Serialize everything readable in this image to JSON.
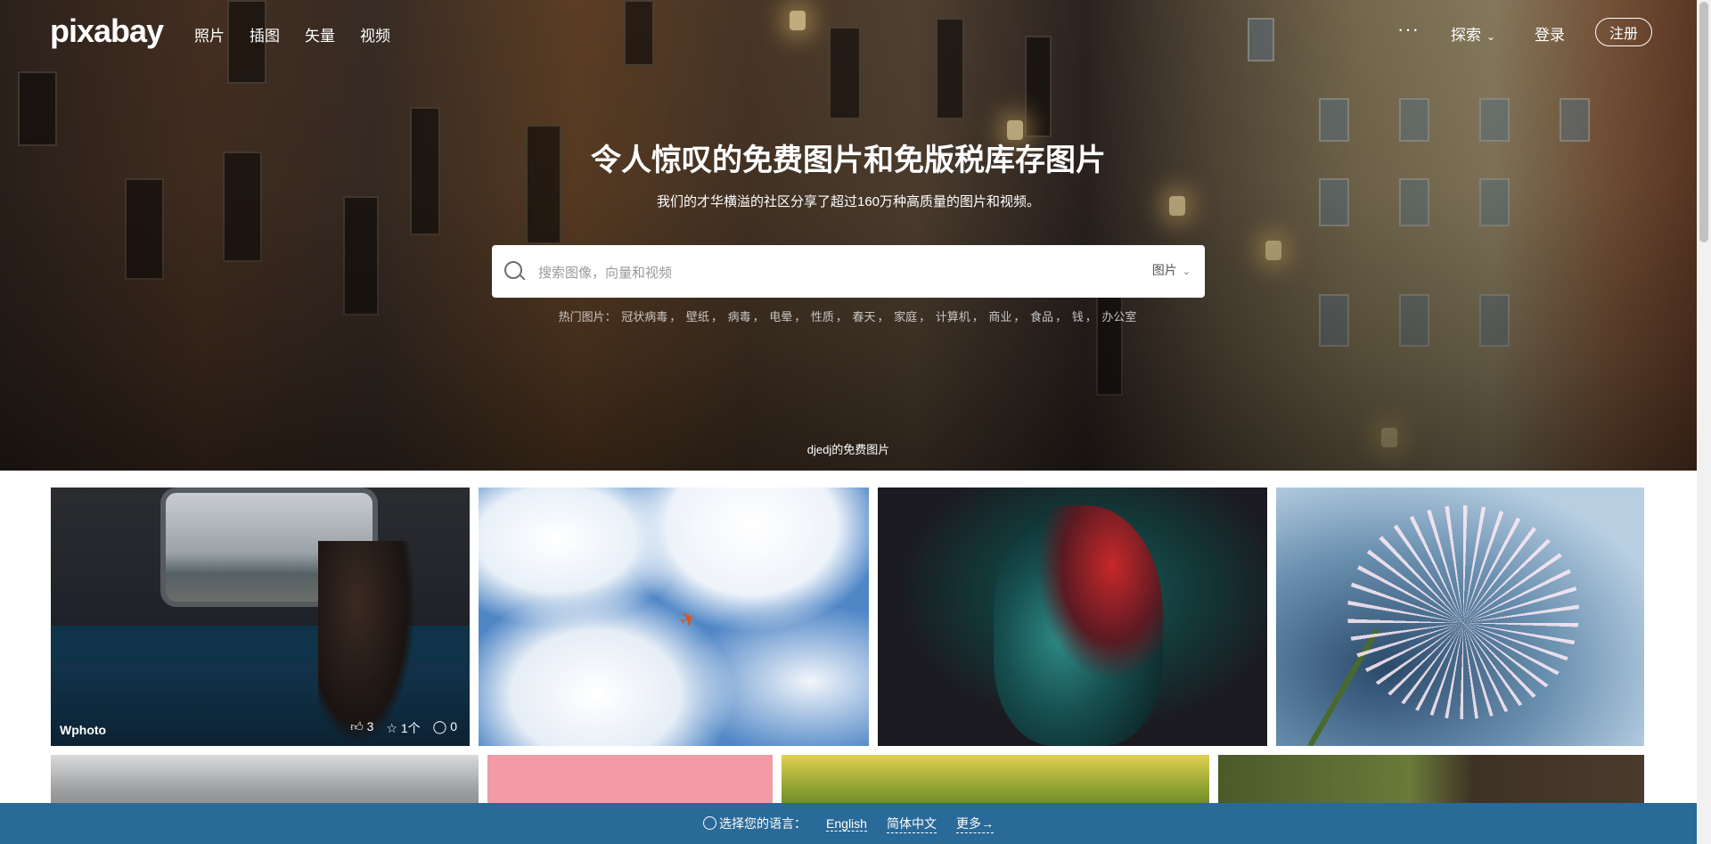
{
  "nav": {
    "logo": "pixabay",
    "links": [
      "照片",
      "插图",
      "矢量",
      "视频"
    ],
    "more": "···",
    "explore": "探索",
    "login": "登录",
    "register": "注册"
  },
  "hero": {
    "headline": "令人惊叹的免费图片和免版税库存图片",
    "subline": "我们的才华横溢的社区分享了超过160万种高质量的图片和视频。",
    "search": {
      "placeholder": "搜索图像，向量和视频",
      "type": "图片"
    },
    "trending_label": "热门图片：",
    "trending": [
      "冠状病毒",
      "壁纸",
      "病毒",
      "电晕",
      "性质",
      "春天",
      "家庭",
      "计算机",
      "商业",
      "食品",
      "钱",
      "办公室"
    ],
    "credit": "djedj的免费图片"
  },
  "gallery": {
    "first_tile": {
      "user": "Wphoto",
      "likes": "3",
      "favorites": "1个",
      "comments": "0"
    }
  },
  "language_bar": {
    "prompt": "选择您的语言：",
    "options": [
      "English",
      "简体中文"
    ],
    "more": "更多→"
  },
  "colors": {
    "language_bar": "#2a6a98",
    "page_bg": "#ffffff"
  }
}
